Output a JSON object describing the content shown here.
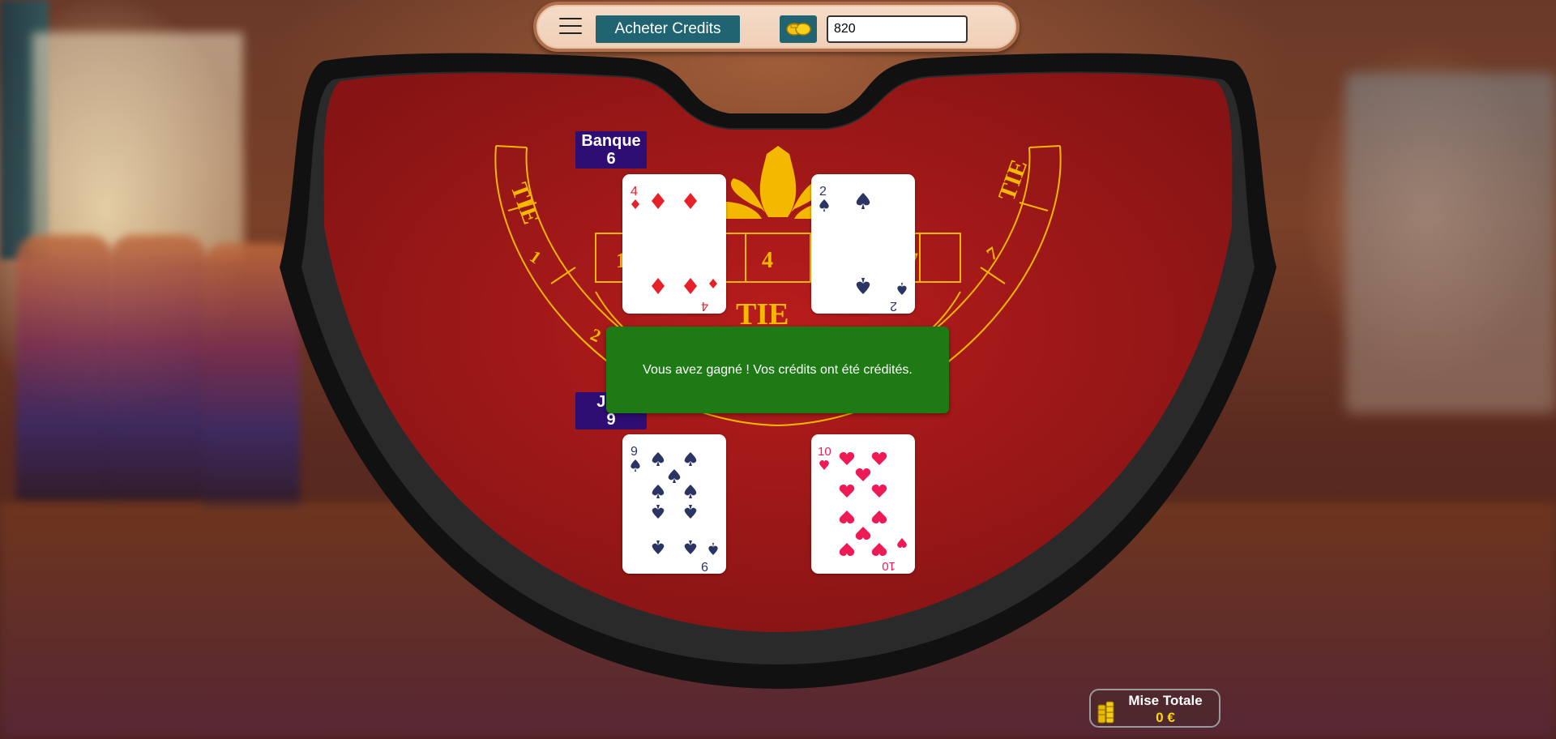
{
  "header": {
    "menu_icon": "hamburger-menu-icon",
    "buy_credits_label": "Acheter Credits",
    "coin_icon": "coins-icon",
    "credits_value": "820"
  },
  "table": {
    "felt_color": "#a41818",
    "gold_color": "#f5b800",
    "tie_label": "TIE",
    "bet_numbers": [
      "1",
      "2",
      "4",
      "7"
    ]
  },
  "bank": {
    "label": "Banque",
    "score": "6",
    "cards": [
      {
        "rank": "4",
        "suit": "diamonds",
        "color": "#e8202a"
      },
      {
        "rank": "2",
        "suit": "spades",
        "color": "#2a3563"
      }
    ]
  },
  "player": {
    "label": "Joueur",
    "label_visible": "Jou",
    "score": "9",
    "cards": [
      {
        "rank": "9",
        "suit": "spades",
        "color": "#2a3563"
      },
      {
        "rank": "10",
        "suit": "hearts",
        "color": "#ee1a55"
      }
    ]
  },
  "notification": {
    "message": "Vous avez gagné ! Vos crédits ont été crédités."
  },
  "total_bet": {
    "title": "Mise Totale",
    "amount": "0 €",
    "icon": "chip-stack-icon"
  }
}
